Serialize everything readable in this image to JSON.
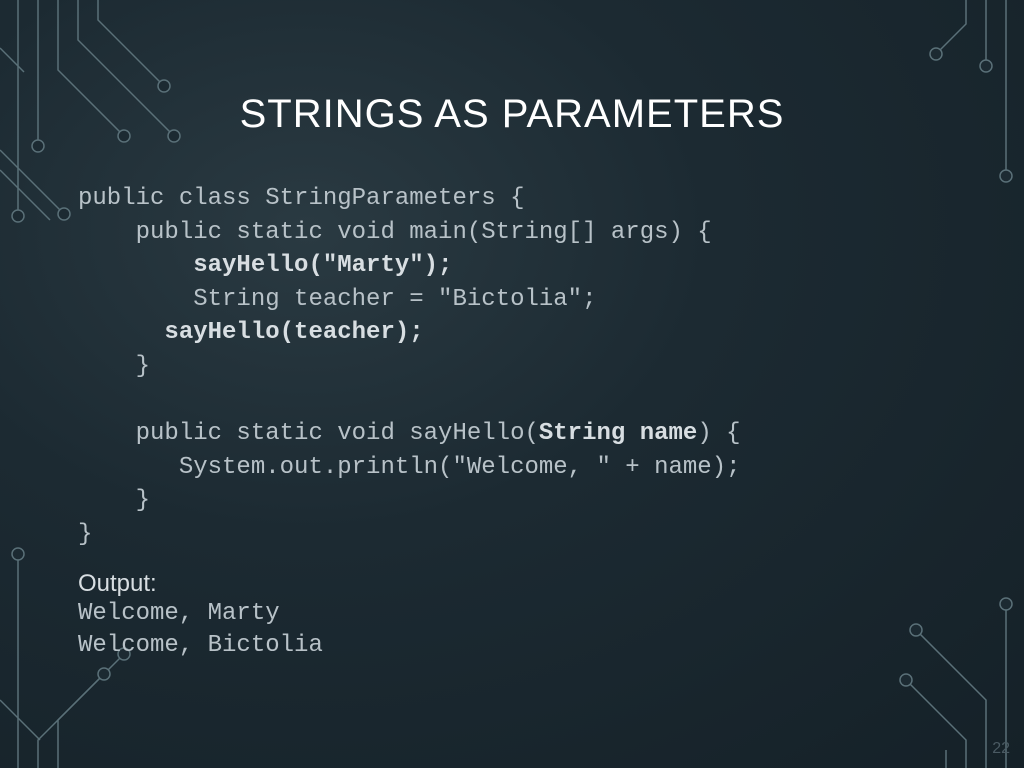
{
  "slide": {
    "title": "STRINGS AS PARAMETERS",
    "page_number": "22"
  },
  "code": {
    "l1": "public class StringParameters {",
    "l2": "    public static void main(String[] args) {",
    "l3a": "        ",
    "l3b": "sayHello(\"Marty\");",
    "l4": "        String teacher = \"Bictolia\";",
    "l5a": "      ",
    "l5b": "sayHello(teacher);",
    "l6": "    }",
    "l7": "",
    "l8a": "    public static void sayHello(",
    "l8b": "String name",
    "l8c": ") {",
    "l9": "       System.out.println(\"Welcome, \" + name);",
    "l10": "    }",
    "l11": "}"
  },
  "output": {
    "label": "Output:",
    "line1": "Welcome, Marty",
    "line2": "Welcome, Bictolia"
  }
}
